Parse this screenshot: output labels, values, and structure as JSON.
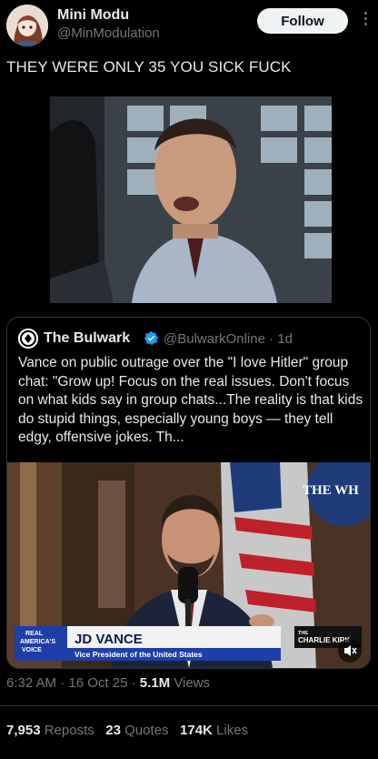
{
  "author": {
    "name": "Mini Modu",
    "handle": "@MinModulation",
    "follow_label": "Follow"
  },
  "tweet": {
    "text": "THEY WERE ONLY 35 YOU SICK FUCK"
  },
  "quote": {
    "name": "The Bulwark",
    "handle": "@BulwarkOnline",
    "age": "1d",
    "text": "Vance on public outrage over the \"I love Hitler\" group chat: \"Grow up! Focus on the real issues. Don't focus on what kids say in group chats...The reality is that kids do stupid things, especially young boys — they tell edgy, offensive jokes. Th...",
    "lower_third": {
      "logo_line1": "REAL",
      "logo_line2": "AMERICA'S",
      "logo_line3": "VOICE",
      "title": "JD VANCE",
      "subtitle": "Vice President of the United States",
      "brand_top": "THE",
      "brand": "CHARLIE KIRK",
      "wall_sign": "THE WH"
    }
  },
  "meta": {
    "time": "6:32 AM",
    "date": "16 Oct 25",
    "views_count": "5.1M",
    "views_label": "Views"
  },
  "stats": {
    "reposts_count": "7,953",
    "reposts_label": "Reposts",
    "quotes_count": "23",
    "quotes_label": "Quotes",
    "likes_count": "174K",
    "likes_label": "Likes"
  },
  "colors": {
    "background": "#000000",
    "text_primary": "#e7e9ea",
    "text_secondary": "#71767b",
    "border": "#2f3336",
    "verified": "#1d9bf0"
  },
  "icons": [
    "more-icon",
    "verified-badge-icon",
    "mute-icon"
  ]
}
